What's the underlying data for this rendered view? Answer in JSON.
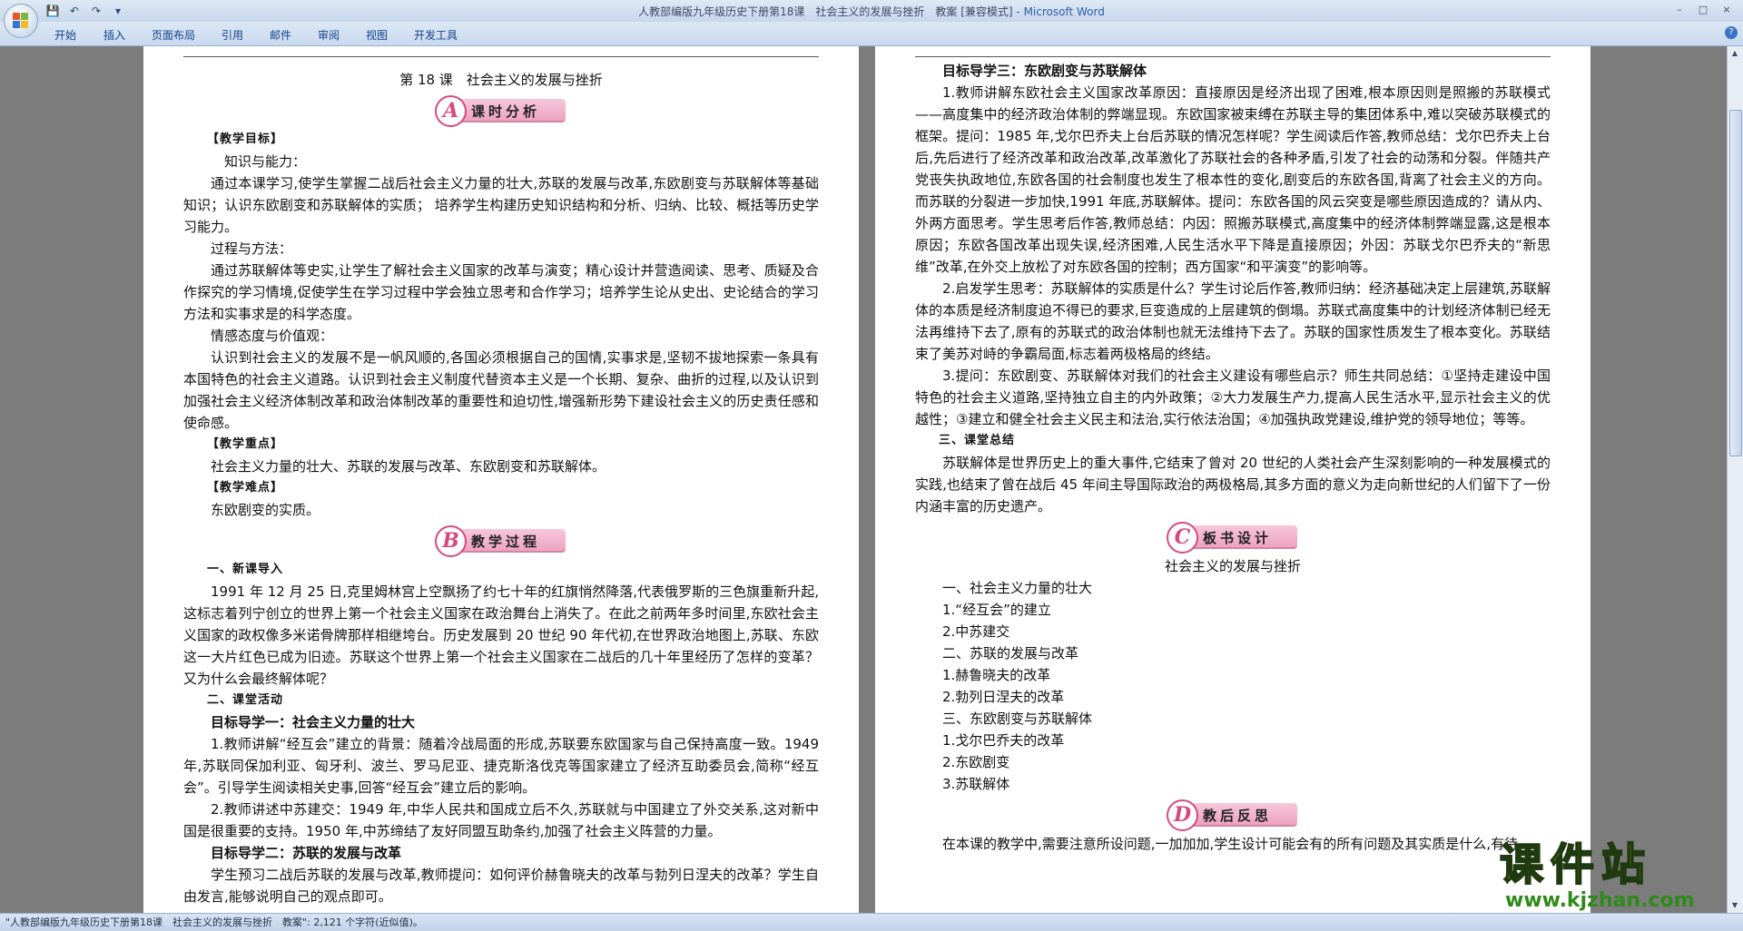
{
  "window": {
    "title": "人教部编版九年级历史下册第18课　社会主义的发展与挫折　教案 [兼容模式]",
    "app_name": " - Microsoft Word",
    "qat_save_icon": "save-icon",
    "qat_undo_icon": "undo-icon",
    "qat_redo_icon": "redo-icon",
    "minimize": "–",
    "maximize": "□",
    "close": "×"
  },
  "ribbon": {
    "tabs": [
      "开始",
      "插入",
      "页面布局",
      "引用",
      "邮件",
      "审阅",
      "视图",
      "开发工具"
    ],
    "help": "?"
  },
  "left_page": {
    "title": "第 18 课　社会主义的发展与挫折",
    "banner_a": {
      "letter": "A",
      "text": "课时分析"
    },
    "teaching_goal_head": "【教学目标】",
    "knowledge_head": "知识与能力：",
    "knowledge_text": "通过本课学习,使学生掌握二战后社会主义力量的壮大,苏联的发展与改革,东欧剧变与苏联解体等基础知识；认识东欧剧变和苏联解体的实质； 培养学生构建历史知识结构和分析、归纳、比较、概括等历史学习能力。",
    "process_head": "过程与方法：",
    "process_text": "通过苏联解体等史实,让学生了解社会主义国家的改革与演变；精心设计并营造阅读、思考、质疑及合作探究的学习情境,促使学生在学习过程中学会独立思考和合作学习；培养学生论从史出、史论结合的学习方法和实事求是的科学态度。",
    "emotion_head": "情感态度与价值观：",
    "emotion_text": "认识到社会主义的发展不是一帆风顺的,各国必须根据自己的国情,实事求是,坚韧不拔地探索一条具有本国特色的社会主义道路。认识到社会主义制度代替资本主义是一个长期、复杂、曲折的过程,以及认识到加强社会主义经济体制改革和政治体制改革的重要性和迫切性,增强新形势下建设社会主义的历史责任感和使命感。",
    "key_head": "【教学重点】",
    "key_text": "社会主义力量的壮大、苏联的发展与改革、东欧剧变和苏联解体。",
    "difficult_head": "【教学难点】",
    "difficult_text": "东欧剧变的实质。",
    "banner_b": {
      "letter": "B",
      "text": "教学过程"
    },
    "intro_head": "一、新课导入",
    "intro_text": "1991 年 12 月 25 日,克里姆林宫上空飘扬了约七十年的红旗悄然降落,代表俄罗斯的三色旗重新升起,这标志着列宁创立的世界上第一个社会主义国家在政治舞台上消失了。在此之前两年多时间里,东欧社会主义国家的政权像多米诺骨牌那样相继垮台。历史发展到 20 世纪 90 年代初,在世界政治地图上,苏联、东欧这一大片红色已成为旧迹。苏联这个世界上第一个社会主义国家在二战后的几十年里经历了怎样的变革？又为什么会最终解体呢？",
    "activity_head": "二、课堂活动",
    "guide1_head": "目标导学一：社会主义力量的壮大",
    "guide1_p1": "1.教师讲解“经互会”建立的背景：随着冷战局面的形成,苏联要东欧国家与自己保持高度一致。1949 年,苏联同保加利亚、匈牙利、波兰、罗马尼亚、捷克斯洛伐克等国家建立了经济互助委员会,简称“经互会”。引导学生阅读相关史事,回答“经互会”建立后的影响。",
    "guide1_p2": "2.教师讲述中苏建交：1949 年,中华人民共和国成立后不久,苏联就与中国建立了外交关系,这对新中国是很重要的支持。1950 年,中苏缔结了友好同盟互助条约,加强了社会主义阵营的力量。",
    "guide2_head": "目标导学二：苏联的发展与改革",
    "guide2_p1": "学生预习二战后苏联的发展与改革,教师提问：如何评价赫鲁晓夫的改革与勃列日涅夫的改革？学生自由发言,能够说明自己的观点即可。"
  },
  "right_page": {
    "guide3_head": "目标导学三：东欧剧变与苏联解体",
    "guide3_p1": "1.教师讲解东欧社会主义国家改革原因：直接原因是经济出现了困难,根本原因则是照搬的苏联模式——高度集中的经济政治体制的弊端显现。东欧国家被束缚在苏联主导的集团体系中,难以突破苏联模式的框架。提问：1985 年,戈尔巴乔夫上台后苏联的情况怎样呢？学生阅读后作答,教师总结：戈尔巴乔夫上台后,先后进行了经济改革和政治改革,改革激化了苏联社会的各种矛盾,引发了社会的动荡和分裂。伴随共产党丧失执政地位,东欧各国的社会制度也发生了根本性的变化,剧变后的东欧各国,背离了社会主义的方向。而苏联的分裂进一步加快,1991 年底,苏联解体。提问：东欧各国的风云突变是哪些原因造成的？请从内、外两方面思考。学生思考后作答,教师总结：内因：照搬苏联模式,高度集中的经济体制弊端显露,这是根本原因；东欧各国改革出现失误,经济困难,人民生活水平下降是直接原因；外因：苏联戈尔巴乔夫的“新思维”改革,在外交上放松了对东欧各国的控制；西方国家“和平演变”的影响等。",
    "guide3_p2": "2.启发学生思考：苏联解体的实质是什么？学生讨论后作答,教师归纳：经济基础决定上层建筑,苏联解体的本质是经济制度迫不得已的要求,巨变造成的上层建筑的倒塌。苏联式高度集中的计划经济体制已经无法再维持下去了,原有的苏联式的政治体制也就无法维持下去了。苏联的国家性质发生了根本变化。苏联结束了美苏对峙的争霸局面,标志着两极格局的终结。",
    "guide3_p3": "3.提问：东欧剧变、苏联解体对我们的社会主义建设有哪些启示？师生共同总结：①坚持走建设中国特色的社会主义道路,坚持独立自主的内外政策；②大力发展生产力,提高人民生活水平,显示社会主义的优越性；③建立和健全社会主义民主和法治,实行依法治国；④加强执政党建设,维护党的领导地位；等等。",
    "summary_head": "三、课堂总结",
    "summary_text": "苏联解体是世界历史上的重大事件,它结束了曾对 20 世纪的人类社会产生深刻影响的一种发展模式的实践,也结束了曾在战后 45 年间主导国际政治的两极格局,其多方面的意义为走向新世纪的人们留下了一份内涵丰富的历史遗产。",
    "banner_c": {
      "letter": "C",
      "text": "板书设计"
    },
    "board_title": "社会主义的发展与挫折",
    "board_items": [
      "一、社会主义力量的壮大",
      "1.“经互会”的建立",
      "2.中苏建交",
      "二、苏联的发展与改革",
      "1.赫鲁晓夫的改革",
      "2.勃列日涅夫的改革",
      "三、东欧剧变与苏联解体",
      "1.戈尔巴乔夫的改革",
      "2.东欧剧变",
      "3.苏联解体"
    ],
    "banner_d": {
      "letter": "D",
      "text": "教后反思"
    },
    "reflection_text": "在本课的教学中,需要注意所设问题,一加加加,学生设计可能会有的所有问题及其实质是什么,有待"
  },
  "status": {
    "text": "\"人教部编版九年级历史下册第18课　社会主义的发展与挫折　教案\": 2,121 个字符(近似值)。"
  },
  "watermark": {
    "big": "课件站",
    "url": "www.kjzhan.com"
  },
  "colors": {
    "accent_pink": "#d64a7b",
    "ribbon_blue": "#15428b",
    "watermark_yellow": "#f5e40f",
    "watermark_green": "#2f8a1a"
  }
}
